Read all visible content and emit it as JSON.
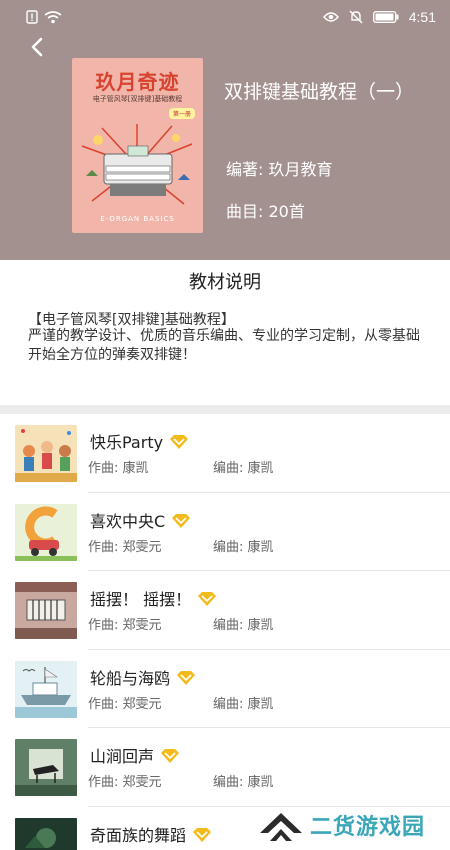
{
  "status": {
    "time": "4:51"
  },
  "book": {
    "cover_title": "玖月奇迹",
    "cover_subtitle": "电子管风琴[双排键]基础教程",
    "cover_volume": "第一册",
    "cover_bottom": "E-ORGAN BASICS",
    "title": "双排键基础教程（一）",
    "author": "编著:  玖月教育",
    "count": "曲目:  20首"
  },
  "description": {
    "heading": "教材说明",
    "line1": "【电子管风琴[双排键]基础教程】",
    "body": "严谨的教学设计、优质的音乐编曲、专业的学习定制，从零基础开始全方位的弹奏双排键！"
  },
  "songs": [
    {
      "name": "快乐Party",
      "composer": "作曲:  康凯",
      "arranger": "编曲:  康凯"
    },
    {
      "name": "喜欢中央C",
      "composer": "作曲:  郑雯元",
      "arranger": "编曲:  康凯"
    },
    {
      "name": "摇摆！ 摇摆！",
      "composer": "作曲:  郑雯元",
      "arranger": "编曲:  康凯"
    },
    {
      "name": "轮船与海鸥",
      "composer": "作曲:  郑雯元",
      "arranger": "编曲:  康凯"
    },
    {
      "name": "山涧回声",
      "composer": "作曲:  郑雯元",
      "arranger": "编曲:  康凯"
    },
    {
      "name": "奇面族的舞蹈",
      "composer": "",
      "arranger": ""
    }
  ],
  "watermark": {
    "text": "二货游戏园"
  },
  "colors": {
    "header": "#a2918f",
    "vip_gold": "#f2bb1b",
    "watermark": "#3aa6b8"
  }
}
